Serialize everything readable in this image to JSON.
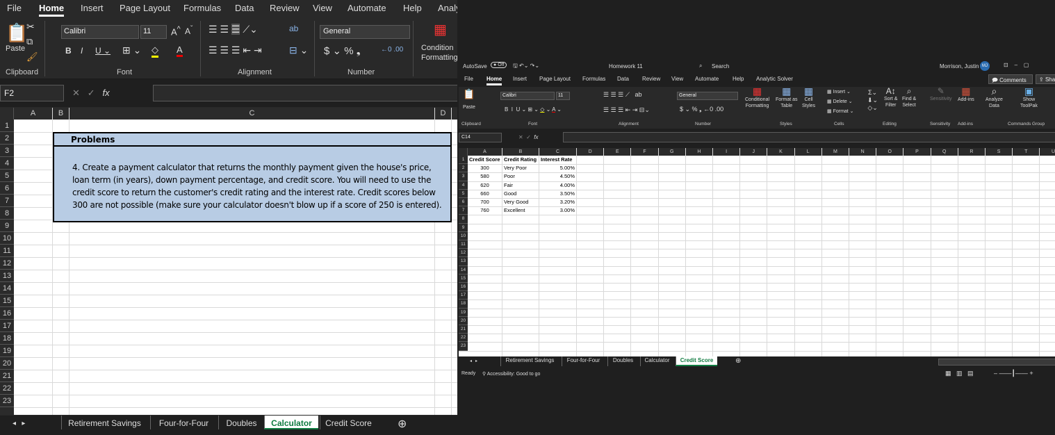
{
  "left": {
    "menu_tabs": [
      "File",
      "Home",
      "Insert",
      "Page Layout",
      "Formulas",
      "Data",
      "Review",
      "View",
      "Automate",
      "Help",
      "Analy"
    ],
    "active_tab": "Home",
    "ribbon": {
      "paste": "Paste",
      "font_name": "Calibri",
      "font_size": "11",
      "number_format": "General",
      "conditional_formatting": [
        "Condition",
        "Formatting"
      ],
      "groups": [
        "Clipboard",
        "Font",
        "Alignment",
        "Number"
      ]
    },
    "name_box": "F2",
    "columns": [
      "A",
      "B",
      "C",
      "D"
    ],
    "rows": [
      "1",
      "2",
      "3",
      "4",
      "5",
      "6",
      "7",
      "8",
      "9",
      "10",
      "11",
      "12",
      "13",
      "14",
      "15",
      "16",
      "17",
      "18",
      "19",
      "20",
      "21",
      "22",
      "23"
    ],
    "problems_title": "Problems",
    "problems_text": [
      "4. Create a payment calculator that returns the monthly payment given the house's price,",
      "loan term (in years), down payment percentage, and credit score.  You will need to use the",
      "credit score to return the customer's credit rating and the interest rate.  Credit scores below",
      "300 are not possible (make sure your calculator doesn't blow up if a score of 250 is entered)."
    ],
    "sheet_tabs": [
      "Retirement Savings",
      "Four-for-Four",
      "Doubles",
      "Calculator",
      "Credit Score"
    ],
    "active_sheet": "Calculator"
  },
  "right": {
    "autosave": "AutoSave",
    "autosave_state": "Off",
    "doc_title": "Homework 11",
    "search": "Search",
    "user": "Morrison, Justin",
    "user_initials": "MJ",
    "menu_tabs": [
      "File",
      "Home",
      "Insert",
      "Page Layout",
      "Formulas",
      "Data",
      "Review",
      "View",
      "Automate",
      "Help",
      "Analytic Solver"
    ],
    "active_tab": "Home",
    "comments": "Comments",
    "share": "Shar",
    "ribbon": {
      "paste": "Paste",
      "font_name": "Calibri",
      "font_size": "11",
      "number_format": "General",
      "conditional": [
        "Conditional",
        "Formatting"
      ],
      "format_table": [
        "Format as",
        "Table"
      ],
      "cell_styles": [
        "Cell",
        "Styles"
      ],
      "insert": "Insert",
      "delete": "Delete",
      "format": "Format",
      "sort_filter": [
        "Sort &",
        "Filter"
      ],
      "find_select": [
        "Find &",
        "Select"
      ],
      "sensitivity": "Sensitivity",
      "addins": "Add-ins",
      "analyze": [
        "Analyze",
        "Data"
      ],
      "toolpak": [
        "Show",
        "ToolPak"
      ],
      "groups": [
        "Clipboard",
        "Font",
        "Alignment",
        "Number",
        "Styles",
        "Cells",
        "Editing",
        "Sensitivity",
        "Add-ins",
        "Commands Group"
      ]
    },
    "name_box": "C14",
    "columns": [
      "A",
      "B",
      "C",
      "D",
      "E",
      "F",
      "G",
      "H",
      "I",
      "J",
      "K",
      "L",
      "M",
      "N",
      "O",
      "P",
      "Q",
      "R",
      "S",
      "T",
      "U"
    ],
    "rows": [
      "1",
      "2",
      "3",
      "4",
      "5",
      "6",
      "7",
      "8",
      "9",
      "10",
      "11",
      "12",
      "13",
      "14",
      "15",
      "16",
      "17",
      "18",
      "19",
      "20",
      "21",
      "22",
      "23"
    ],
    "table": {
      "headers": [
        "Credit Score",
        "Credit Rating",
        "Interest Rate"
      ],
      "rows": [
        [
          "300",
          "Very Poor",
          "5.00%"
        ],
        [
          "580",
          "Poor",
          "4.50%"
        ],
        [
          "620",
          "Fair",
          "4.00%"
        ],
        [
          "660",
          "Good",
          "3.50%"
        ],
        [
          "700",
          "Very Good",
          "3.20%"
        ],
        [
          "760",
          "Excellent",
          "3.00%"
        ]
      ]
    },
    "sheet_tabs": [
      "Retirement Savings",
      "Four-for-Four",
      "Doubles",
      "Calculator",
      "Credit Score"
    ],
    "active_sheet": "Credit Score",
    "status": "Ready",
    "accessibility": "Accessibility: Good to go"
  },
  "colors": {
    "accent": "#107c41",
    "problems_fill": "#b8cce4",
    "user_badge": "#2b6cb0"
  }
}
